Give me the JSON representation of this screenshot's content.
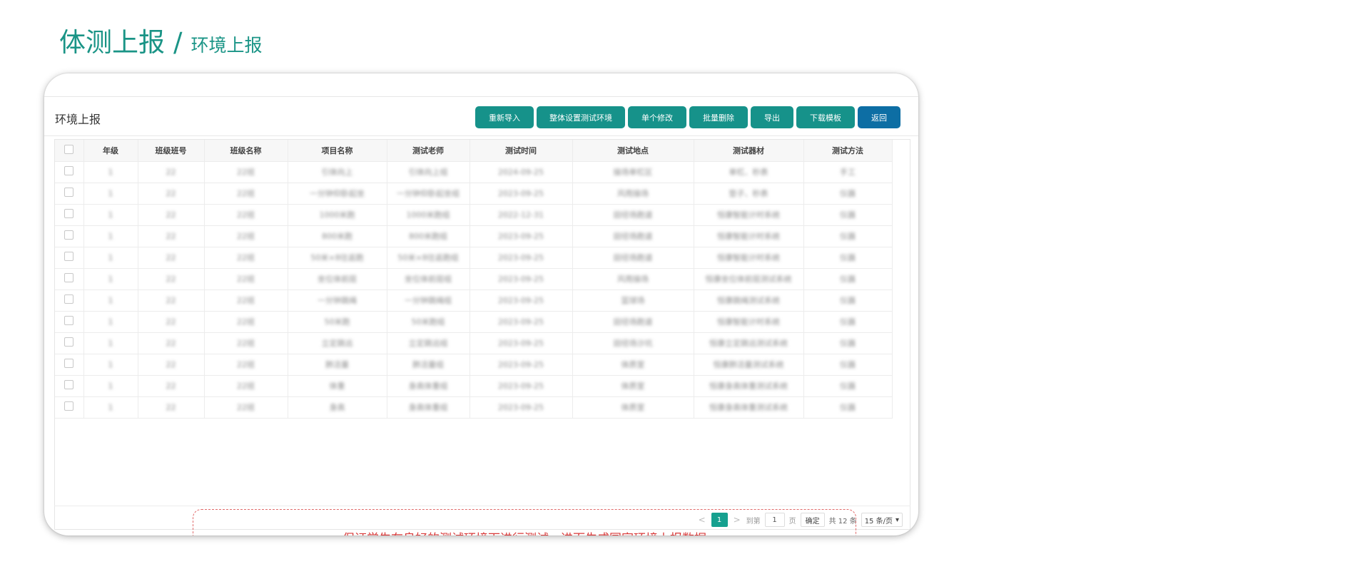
{
  "breadcrumb": {
    "main": "体测上报",
    "separator": "/",
    "sub": "环境上报"
  },
  "panel": {
    "title": "环境上报"
  },
  "toolbar": {
    "buttons": [
      {
        "label": "重新导入"
      },
      {
        "label": "整体设置测试环境"
      },
      {
        "label": "单个修改"
      },
      {
        "label": "批量删除"
      },
      {
        "label": "导出"
      },
      {
        "label": "下载模板"
      },
      {
        "label": "返回"
      }
    ]
  },
  "table": {
    "headers": [
      "年级",
      "班级班号",
      "班级名称",
      "项目名称",
      "测试老师",
      "测试时间",
      "测试地点",
      "测试器材",
      "测试方法"
    ],
    "rows": [
      [
        "1",
        "22",
        "22班",
        "引体向上",
        "引体向上组",
        "2024-09-25",
        "操场单杠区",
        "单杠、秒表",
        "手工"
      ],
      [
        "1",
        "22",
        "22班",
        "一分钟仰卧起坐",
        "一分钟仰卧起坐组",
        "2023-09-25",
        "风雨操场",
        "垫子、秒表",
        "仪器"
      ],
      [
        "1",
        "22",
        "22班",
        "1000米跑",
        "1000米跑组",
        "2022-12-31",
        "田径场跑道",
        "恒康智能计时系统",
        "仪器"
      ],
      [
        "1",
        "22",
        "22班",
        "800米跑",
        "800米跑组",
        "2023-09-25",
        "田径场跑道",
        "恒康智能计时系统",
        "仪器"
      ],
      [
        "1",
        "22",
        "22班",
        "50米×8往返跑",
        "50米×8往返跑组",
        "2023-09-25",
        "田径场跑道",
        "恒康智能计时系统",
        "仪器"
      ],
      [
        "1",
        "22",
        "22班",
        "坐位体前屈",
        "坐位体前屈组",
        "2023-09-25",
        "风雨操场",
        "恒康坐位体前屈测试系统",
        "仪器"
      ],
      [
        "1",
        "22",
        "22班",
        "一分钟跳绳",
        "一分钟跳绳组",
        "2023-09-25",
        "篮球场",
        "恒康跳绳测试系统",
        "仪器"
      ],
      [
        "1",
        "22",
        "22班",
        "50米跑",
        "50米跑组",
        "2023-09-25",
        "田径场跑道",
        "恒康智能计时系统",
        "仪器"
      ],
      [
        "1",
        "22",
        "22班",
        "立定跳远",
        "立定跳远组",
        "2023-09-25",
        "田径场沙坑",
        "恒康立定跳远测试系统",
        "仪器"
      ],
      [
        "1",
        "22",
        "22班",
        "肺活量",
        "肺活量组",
        "2023-09-25",
        "体质室",
        "恒康肺活量测试系统",
        "仪器"
      ],
      [
        "1",
        "22",
        "22班",
        "体重",
        "身高体重组",
        "2023-09-25",
        "体质室",
        "恒康身高体重测试系统",
        "仪器"
      ],
      [
        "1",
        "22",
        "22班",
        "身高",
        "身高体重组",
        "2023-09-25",
        "体质室",
        "恒康身高体重测试系统",
        "仪器"
      ]
    ]
  },
  "note": "保证学生在良好的测试环境下进行测试，进而生成国家环境上报数据",
  "pagination": {
    "prev": "<",
    "current_page": "1",
    "next": ">",
    "goto_label": "到第",
    "goto_value": "1",
    "page_unit": "页",
    "confirm_label": "确定",
    "total_text": "共 12 条",
    "page_size": "15 条/页"
  },
  "colors": {
    "accent": "#16928a",
    "return_button": "#0d6ea4",
    "note_text": "#d83a3a",
    "heading": "#1a9486"
  }
}
